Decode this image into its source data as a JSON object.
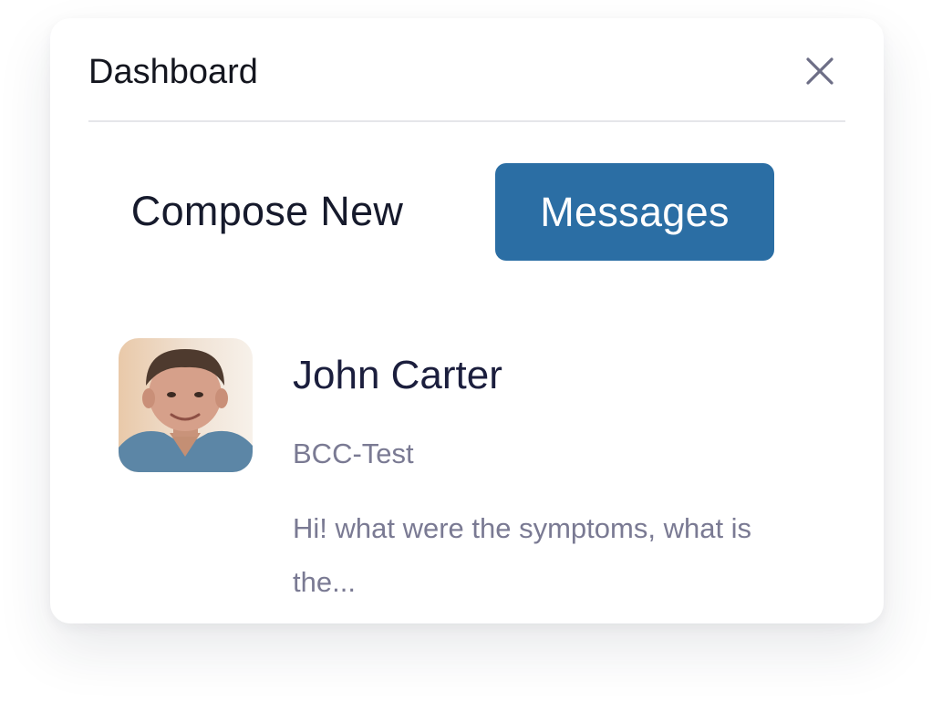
{
  "header": {
    "title": "Dashboard",
    "close_icon": "close-icon"
  },
  "tabs": {
    "compose_label": "Compose New",
    "messages_label": "Messages",
    "active": "Messages"
  },
  "messages": [
    {
      "sender": "John Carter",
      "subject": "BCC-Test",
      "preview": "Hi! what were the symptoms, what is the...",
      "avatar": "avatar-photo"
    }
  ],
  "colors": {
    "accent": "#2b6ea4",
    "title_text": "#14161f",
    "sender_text": "#1b1e3d",
    "muted_text": "#7a7a93",
    "divider": "#e5e6ea"
  }
}
